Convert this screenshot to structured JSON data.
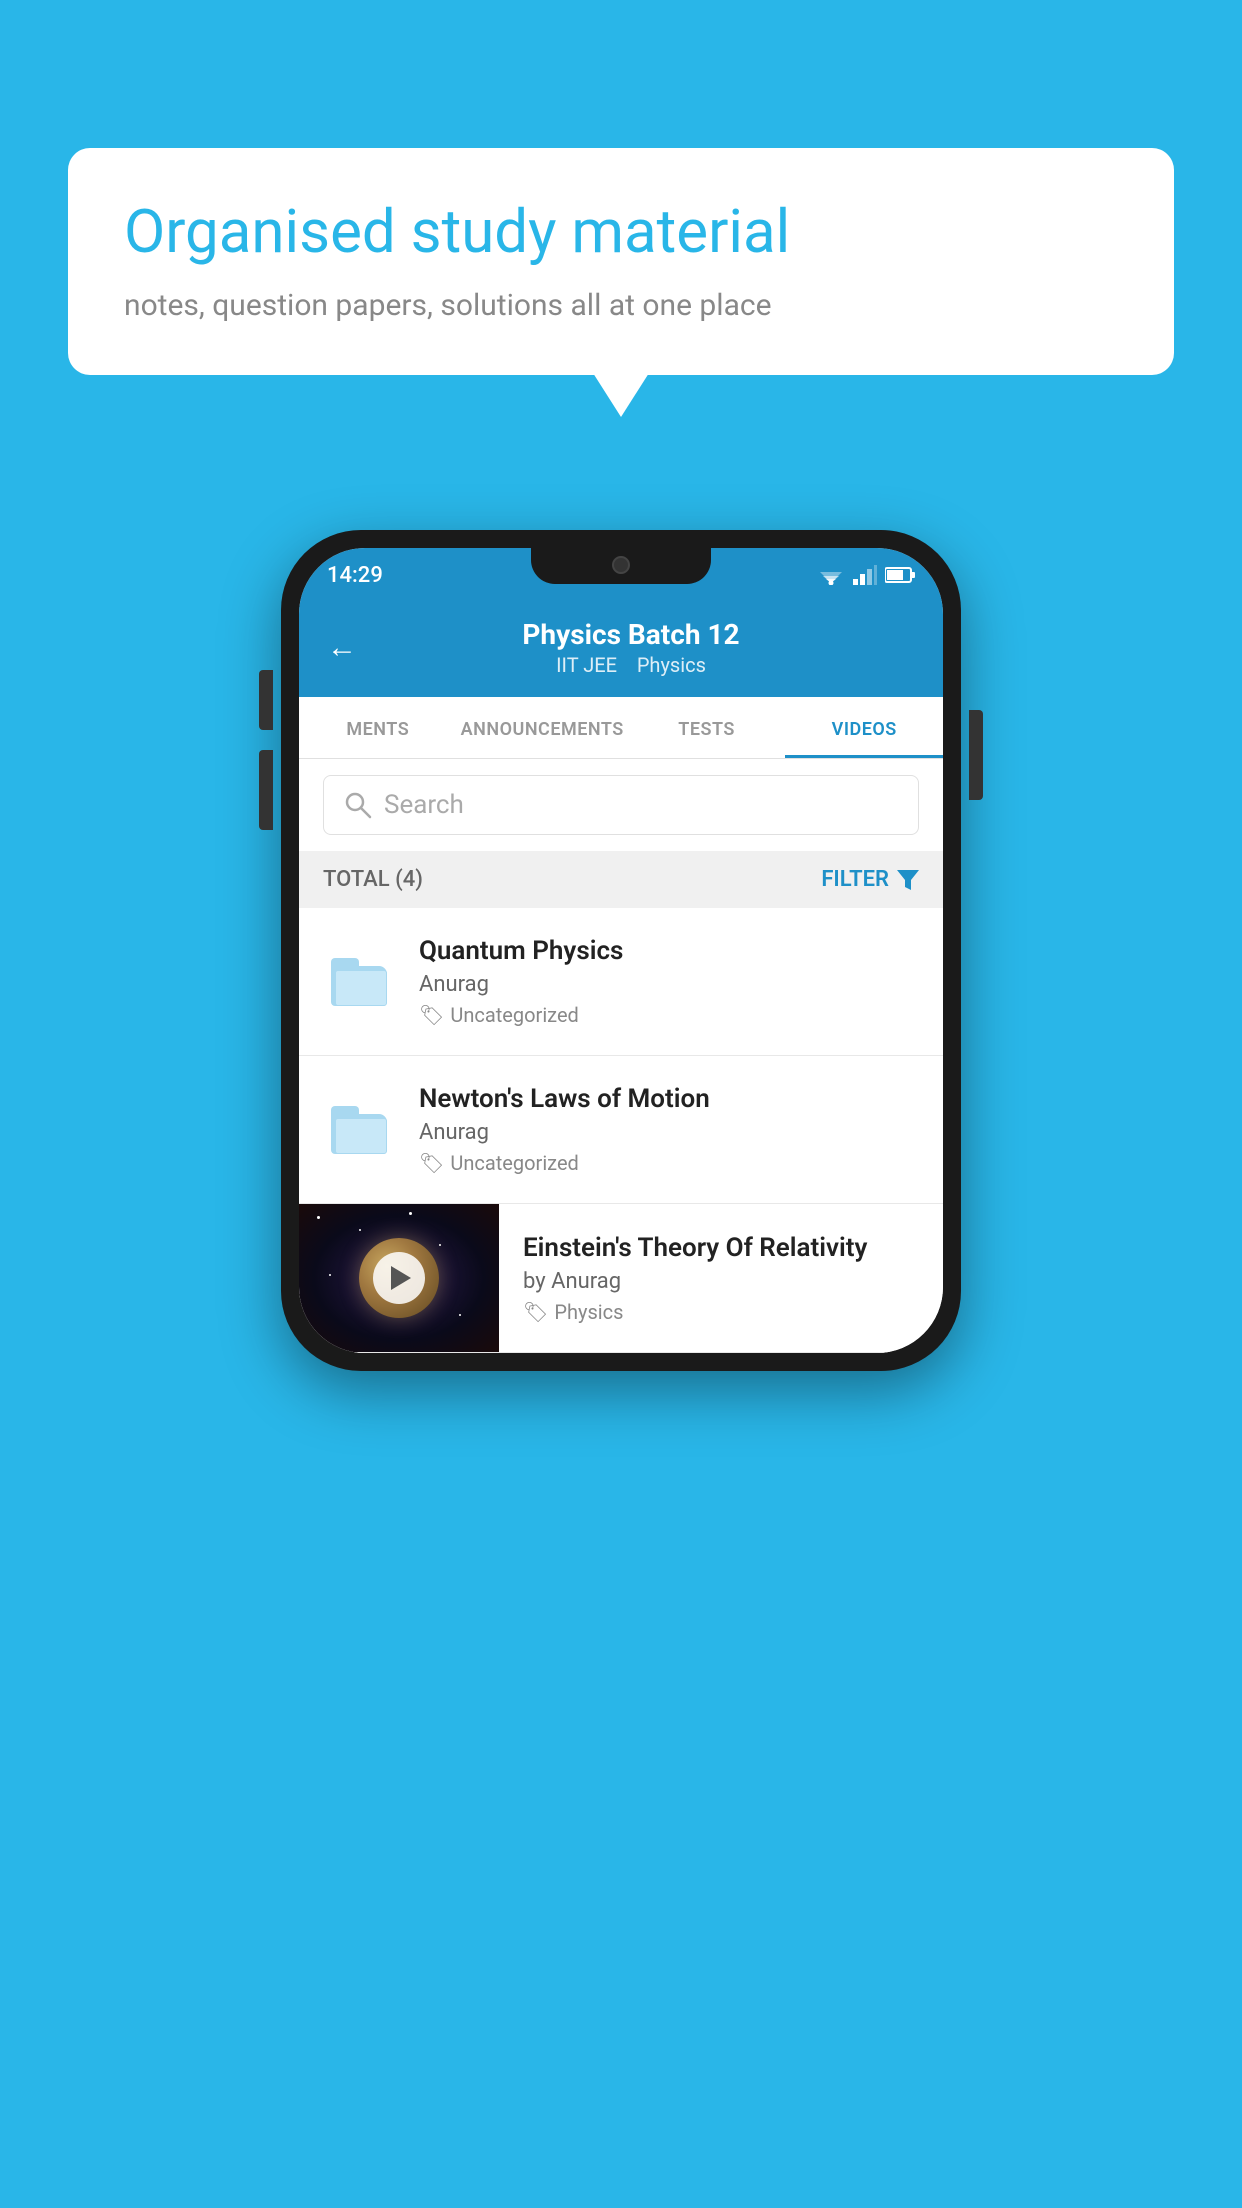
{
  "background_color": "#29b6e8",
  "speech_bubble": {
    "title": "Organised study material",
    "subtitle": "notes, question papers, solutions all at one place"
  },
  "phone": {
    "status_bar": {
      "time": "14:29"
    },
    "header": {
      "back_label": "←",
      "title": "Physics Batch 12",
      "subtitle_part1": "IIT JEE",
      "subtitle_part2": "Physics"
    },
    "tabs": [
      {
        "label": "MENTS",
        "active": false
      },
      {
        "label": "ANNOUNCEMENTS",
        "active": false
      },
      {
        "label": "TESTS",
        "active": false
      },
      {
        "label": "VIDEOS",
        "active": true
      }
    ],
    "search": {
      "placeholder": "Search"
    },
    "filter_row": {
      "total_label": "TOTAL (4)",
      "filter_label": "FILTER"
    },
    "list_items": [
      {
        "type": "folder",
        "title": "Quantum Physics",
        "author": "Anurag",
        "tag": "Uncategorized"
      },
      {
        "type": "folder",
        "title": "Newton's Laws of Motion",
        "author": "Anurag",
        "tag": "Uncategorized"
      },
      {
        "type": "video",
        "title": "Einstein's Theory Of Relativity",
        "author": "by Anurag",
        "tag": "Physics"
      }
    ]
  }
}
